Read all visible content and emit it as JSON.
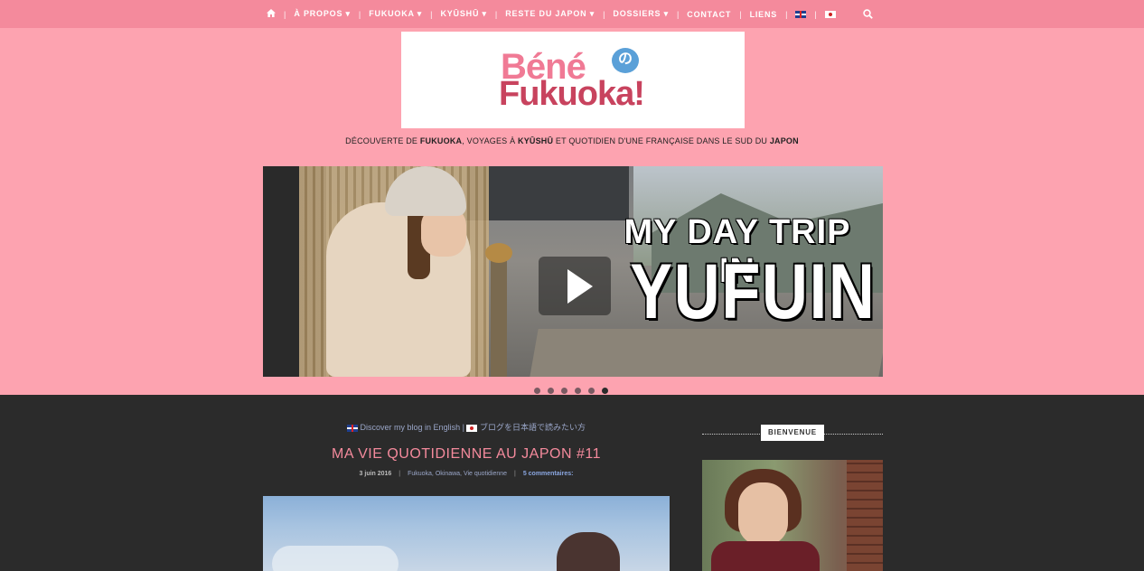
{
  "nav": {
    "items": [
      {
        "label": "À PROPOS ▾"
      },
      {
        "label": "FUKUOKA ▾"
      },
      {
        "label": "KYŪSHŪ ▾"
      },
      {
        "label": "RESTE DU JAPON ▾"
      },
      {
        "label": "DOSSIERS ▾"
      },
      {
        "label": "CONTACT"
      },
      {
        "label": "LIENS"
      }
    ],
    "separator": "|"
  },
  "logo": {
    "line1": "Béné",
    "line2": "Fukuoka!",
    "bubble": "の"
  },
  "tagline": {
    "p1": "Découverte de ",
    "b1": "Fukuoka",
    "p2": ", voyages à ",
    "b2": "Kyūshū",
    "p3": " et quotidien d'une française dans le sud du ",
    "b3": "Japon"
  },
  "slider": {
    "title_line1": "MY DAY TRIP IN",
    "title_line2": "YUFUIN",
    "dot_count": 6,
    "active_index": 5
  },
  "main": {
    "english_link": "Discover my blog in English",
    "link_sep": "|",
    "japanese_link": "ブログを日本語で読みたい方",
    "post_title": "MA VIE QUOTIDIENNE AU JAPON #11",
    "post_date": "3 juin 2016",
    "post_sep": "|",
    "post_categories": [
      "Fukuoka",
      "Okinawa",
      "Vie quotidienne"
    ],
    "post_comments": "5 commentaires:"
  },
  "sidebar": {
    "widget_title": "BIENVENUE"
  },
  "colors": {
    "nav_bg": "#f48a9c",
    "header_bg": "#fda3b0",
    "body_bg": "#2b2b2b",
    "accent": "#f48a9c"
  }
}
